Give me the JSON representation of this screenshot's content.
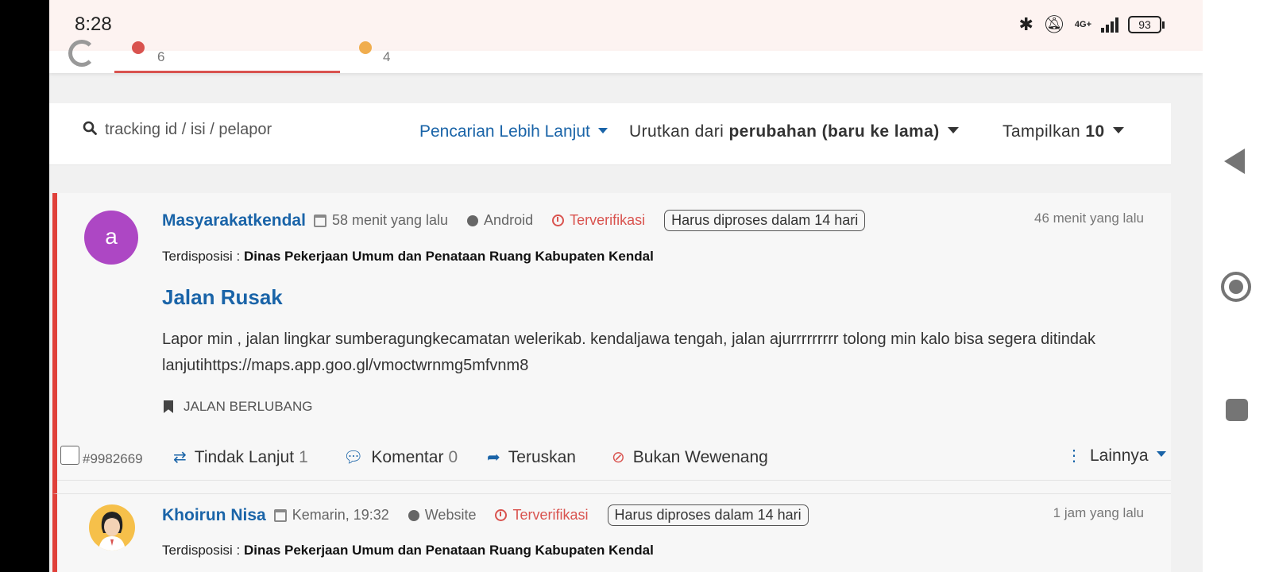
{
  "status_bar": {
    "time": "8:28",
    "network": "4G+",
    "battery": "93"
  },
  "tabs": [
    {
      "count": "6",
      "dot_color": "#d9534f"
    },
    {
      "count": "4",
      "dot_color": "#f0ad4e"
    }
  ],
  "toolbar": {
    "search_placeholder": "tracking id / isi / pelapor",
    "advanced_search": "Pencarian Lebih Lanjut",
    "sort_prefix": "Urutkan dari",
    "sort_value": "perubahan (baru ke lama)",
    "show_prefix": "Tampilkan",
    "show_value": "10"
  },
  "reports": [
    {
      "avatar_letter": "a",
      "avatar_color": "#ad47c4",
      "reporter": "Masyarakatkendal",
      "created": "58 menit yang lalu",
      "source": "Android",
      "status": "Terverifikasi",
      "deadline": "Harus diproses dalam 14 hari",
      "updated": "46 menit yang lalu",
      "disposition_label": "Terdisposisi :",
      "disposition": "Dinas Pekerjaan Umum dan Penataan Ruang Kabupaten Kendal",
      "title": "Jalan Rusak",
      "description": "Lapor min , jalan lingkar sumberagungkecamatan welerikab. kendaljawa tengah, jalan ajurrrrrrrrr tolong min kalo bisa segera ditindak lanjutihttps://maps.app.goo.gl/vmoctwrnmg5mfvnm8",
      "category": "JALAN BERLUBANG",
      "ticket": "#9982669",
      "follow_up_label": "Tindak Lanjut",
      "follow_up_count": "1",
      "comment_label": "Komentar",
      "comment_count": "0",
      "forward_label": "Teruskan",
      "reject_label": "Bukan Wewenang",
      "more_label": "Lainnya"
    },
    {
      "reporter": "Khoirun Nisa",
      "created": "Kemarin, 19:32",
      "source": "Website",
      "status": "Terverifikasi",
      "deadline": "Harus diproses dalam 14 hari",
      "updated": "1 jam yang lalu",
      "disposition_label": "Terdisposisi :",
      "disposition": "Dinas Pekerjaan Umum dan Penataan Ruang Kabupaten Kendal"
    }
  ]
}
